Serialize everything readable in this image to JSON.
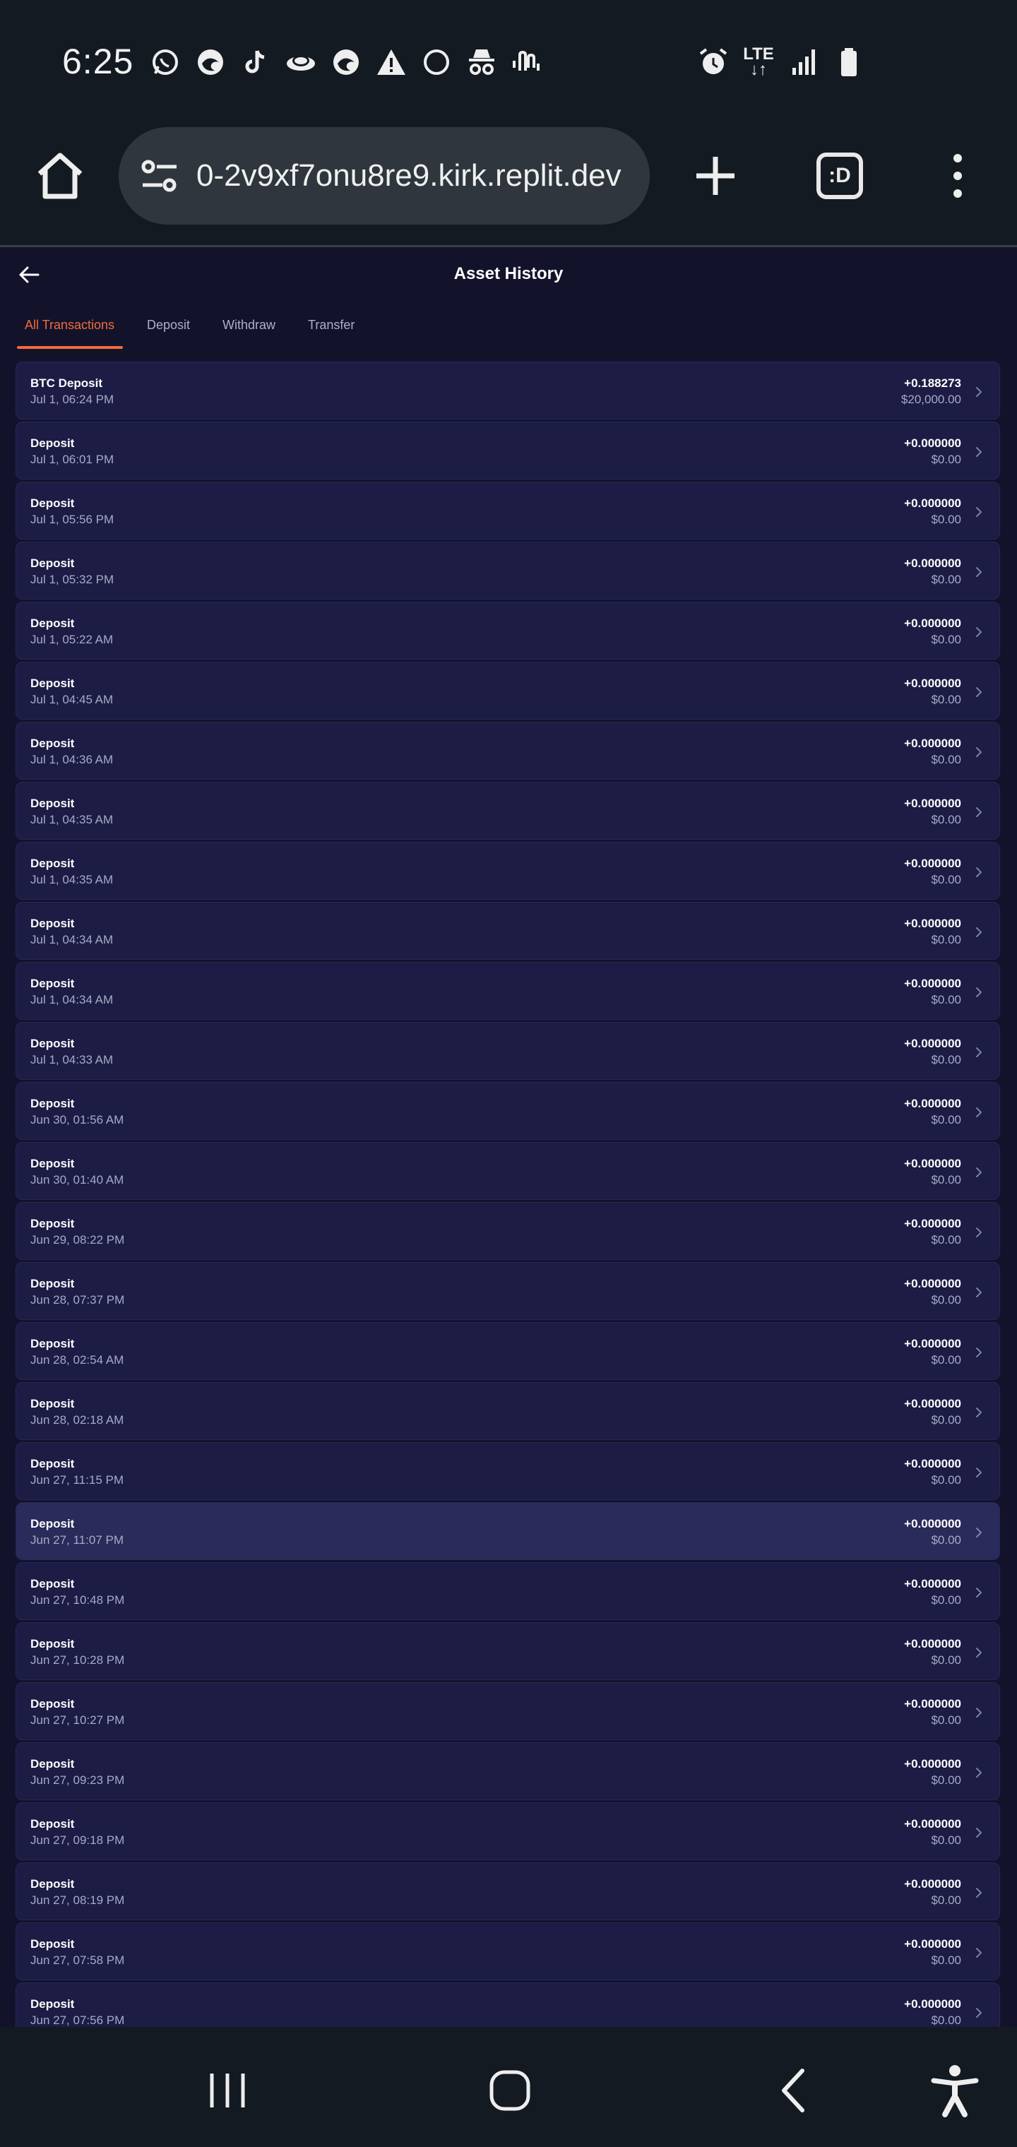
{
  "status_bar": {
    "time": "6:25",
    "left_icons": [
      "whatsapp-icon",
      "edge-icon",
      "tiktok-icon",
      "planet-icon",
      "edge-icon",
      "warning-icon",
      "circle-icon",
      "incognito-icon",
      "audio-wave-icon"
    ],
    "lte_label": "LTE",
    "right_icons": [
      "alarm-icon",
      "signal-icon",
      "battery-icon"
    ]
  },
  "browser": {
    "url": "0-2v9xf7onu8re9.kirk.replit.dev",
    "tabs_label": ":D"
  },
  "header": {
    "title": "Asset History"
  },
  "tabs": [
    {
      "label": "All Transactions",
      "active": true
    },
    {
      "label": "Deposit",
      "active": false
    },
    {
      "label": "Withdraw",
      "active": false
    },
    {
      "label": "Transfer",
      "active": false
    }
  ],
  "transactions": [
    {
      "title": "BTC Deposit",
      "date": "Jul 1, 06:24 PM",
      "amount": "+0.188273",
      "usd": "$20,000.00"
    },
    {
      "title": "Deposit",
      "date": "Jul 1, 06:01 PM",
      "amount": "+0.000000",
      "usd": "$0.00"
    },
    {
      "title": "Deposit",
      "date": "Jul 1, 05:56 PM",
      "amount": "+0.000000",
      "usd": "$0.00"
    },
    {
      "title": "Deposit",
      "date": "Jul 1, 05:32 PM",
      "amount": "+0.000000",
      "usd": "$0.00"
    },
    {
      "title": "Deposit",
      "date": "Jul 1, 05:22 AM",
      "amount": "+0.000000",
      "usd": "$0.00"
    },
    {
      "title": "Deposit",
      "date": "Jul 1, 04:45 AM",
      "amount": "+0.000000",
      "usd": "$0.00"
    },
    {
      "title": "Deposit",
      "date": "Jul 1, 04:36 AM",
      "amount": "+0.000000",
      "usd": "$0.00"
    },
    {
      "title": "Deposit",
      "date": "Jul 1, 04:35 AM",
      "amount": "+0.000000",
      "usd": "$0.00"
    },
    {
      "title": "Deposit",
      "date": "Jul 1, 04:35 AM",
      "amount": "+0.000000",
      "usd": "$0.00"
    },
    {
      "title": "Deposit",
      "date": "Jul 1, 04:34 AM",
      "amount": "+0.000000",
      "usd": "$0.00"
    },
    {
      "title": "Deposit",
      "date": "Jul 1, 04:34 AM",
      "amount": "+0.000000",
      "usd": "$0.00"
    },
    {
      "title": "Deposit",
      "date": "Jul 1, 04:33 AM",
      "amount": "+0.000000",
      "usd": "$0.00"
    },
    {
      "title": "Deposit",
      "date": "Jun 30, 01:56 AM",
      "amount": "+0.000000",
      "usd": "$0.00"
    },
    {
      "title": "Deposit",
      "date": "Jun 30, 01:40 AM",
      "amount": "+0.000000",
      "usd": "$0.00"
    },
    {
      "title": "Deposit",
      "date": "Jun 29, 08:22 PM",
      "amount": "+0.000000",
      "usd": "$0.00"
    },
    {
      "title": "Deposit",
      "date": "Jun 28, 07:37 PM",
      "amount": "+0.000000",
      "usd": "$0.00"
    },
    {
      "title": "Deposit",
      "date": "Jun 28, 02:54 AM",
      "amount": "+0.000000",
      "usd": "$0.00"
    },
    {
      "title": "Deposit",
      "date": "Jun 28, 02:18 AM",
      "amount": "+0.000000",
      "usd": "$0.00"
    },
    {
      "title": "Deposit",
      "date": "Jun 27, 11:15 PM",
      "amount": "+0.000000",
      "usd": "$0.00"
    },
    {
      "title": "Deposit",
      "date": "Jun 27, 11:07 PM",
      "amount": "+0.000000",
      "usd": "$0.00",
      "highlight": true
    },
    {
      "title": "Deposit",
      "date": "Jun 27, 10:48 PM",
      "amount": "+0.000000",
      "usd": "$0.00"
    },
    {
      "title": "Deposit",
      "date": "Jun 27, 10:28 PM",
      "amount": "+0.000000",
      "usd": "$0.00"
    },
    {
      "title": "Deposit",
      "date": "Jun 27, 10:27 PM",
      "amount": "+0.000000",
      "usd": "$0.00"
    },
    {
      "title": "Deposit",
      "date": "Jun 27, 09:23 PM",
      "amount": "+0.000000",
      "usd": "$0.00"
    },
    {
      "title": "Deposit",
      "date": "Jun 27, 09:18 PM",
      "amount": "+0.000000",
      "usd": "$0.00"
    },
    {
      "title": "Deposit",
      "date": "Jun 27, 08:19 PM",
      "amount": "+0.000000",
      "usd": "$0.00"
    },
    {
      "title": "Deposit",
      "date": "Jun 27, 07:58 PM",
      "amount": "+0.000000",
      "usd": "$0.00"
    },
    {
      "title": "Deposit",
      "date": "Jun 27, 07:56 PM",
      "amount": "+0.000000",
      "usd": "$0.00"
    }
  ],
  "colors": {
    "background": "#12132b",
    "row_background": "#1c1c45",
    "row_highlight": "#2a2b5a",
    "accent": "#f26b3a",
    "system_bar": "#141a22"
  }
}
